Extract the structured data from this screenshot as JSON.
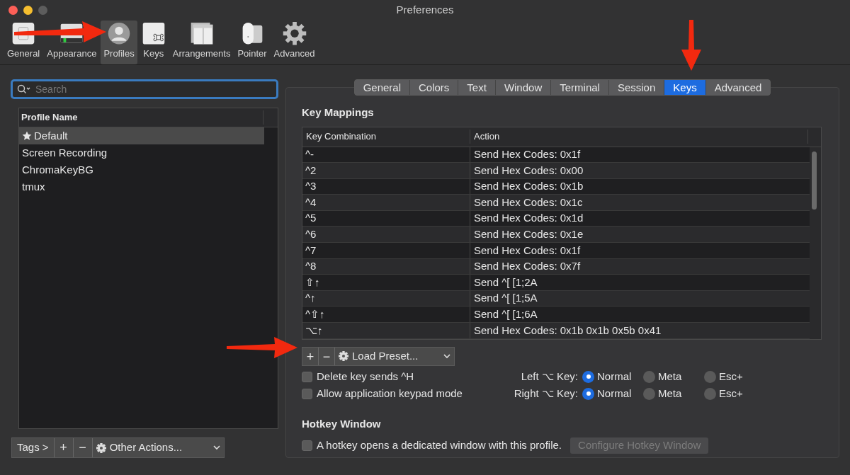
{
  "window": {
    "title": "Preferences"
  },
  "toolbar": [
    {
      "kind": "general",
      "label": "General",
      "selected": false
    },
    {
      "kind": "appearance",
      "label": "Appearance",
      "selected": false
    },
    {
      "kind": "profiles",
      "label": "Profiles",
      "selected": true
    },
    {
      "kind": "keys",
      "label": "Keys",
      "selected": false
    },
    {
      "kind": "arrangements",
      "label": "Arrangements",
      "selected": false
    },
    {
      "kind": "pointer",
      "label": "Pointer",
      "selected": false
    },
    {
      "kind": "advanced",
      "label": "Advanced",
      "selected": false
    }
  ],
  "search": {
    "placeholder": "Search"
  },
  "profiles": {
    "column": "Profile Name",
    "items": [
      {
        "name": "Default",
        "is_default": true,
        "selected": true
      },
      {
        "name": "Screen Recording",
        "is_default": false,
        "selected": false
      },
      {
        "name": "ChromaKeyBG",
        "is_default": false,
        "selected": false
      },
      {
        "name": "tmux",
        "is_default": false,
        "selected": false
      }
    ]
  },
  "profile_buttons": {
    "tags": "Tags >",
    "add": "+",
    "remove": "−",
    "other_actions": "Other Actions..."
  },
  "tabs": [
    {
      "label": "General",
      "selected": false
    },
    {
      "label": "Colors",
      "selected": false
    },
    {
      "label": "Text",
      "selected": false
    },
    {
      "label": "Window",
      "selected": false
    },
    {
      "label": "Terminal",
      "selected": false
    },
    {
      "label": "Session",
      "selected": false
    },
    {
      "label": "Keys",
      "selected": true
    },
    {
      "label": "Advanced",
      "selected": false
    }
  ],
  "key_mappings": {
    "title": "Key Mappings",
    "columns": [
      "Key Combination",
      "Action"
    ],
    "rows": [
      {
        "key": "^-",
        "action": "Send Hex Codes: 0x1f"
      },
      {
        "key": "^2",
        "action": "Send Hex Codes: 0x00"
      },
      {
        "key": "^3",
        "action": "Send Hex Codes: 0x1b"
      },
      {
        "key": "^4",
        "action": "Send Hex Codes: 0x1c"
      },
      {
        "key": "^5",
        "action": "Send Hex Codes: 0x1d"
      },
      {
        "key": "^6",
        "action": "Send Hex Codes: 0x1e"
      },
      {
        "key": "^7",
        "action": "Send Hex Codes: 0x1f"
      },
      {
        "key": "^8",
        "action": "Send Hex Codes: 0x7f"
      },
      {
        "key": "⇧↑",
        "action": "Send ^[ [1;2A"
      },
      {
        "key": "^↑",
        "action": "Send ^[ [1;5A"
      },
      {
        "key": "^⇧↑",
        "action": "Send ^[ [1;6A"
      },
      {
        "key": "⌥↑",
        "action": "Send Hex Codes: 0x1b 0x1b 0x5b 0x41"
      }
    ],
    "add": "+",
    "remove": "−",
    "load_preset": "Load Preset..."
  },
  "checkboxes": [
    {
      "label": "Delete key sends ^H",
      "checked": false
    },
    {
      "label": "Allow application keypad mode",
      "checked": false
    }
  ],
  "option_keys": [
    {
      "label": "Left ⌥ Key:",
      "options": [
        {
          "label": "Normal",
          "selected": true
        },
        {
          "label": "Meta",
          "selected": false
        },
        {
          "label": "Esc+",
          "selected": false
        }
      ]
    },
    {
      "label": "Right ⌥ Key:",
      "options": [
        {
          "label": "Normal",
          "selected": true
        },
        {
          "label": "Meta",
          "selected": false
        },
        {
          "label": "Esc+",
          "selected": false
        }
      ]
    }
  ],
  "hotkey": {
    "title": "Hotkey Window",
    "checkbox": {
      "label": "A hotkey opens a dedicated window with this profile.",
      "checked": false
    },
    "button": {
      "label": "Configure Hotkey Window",
      "disabled": true
    }
  }
}
